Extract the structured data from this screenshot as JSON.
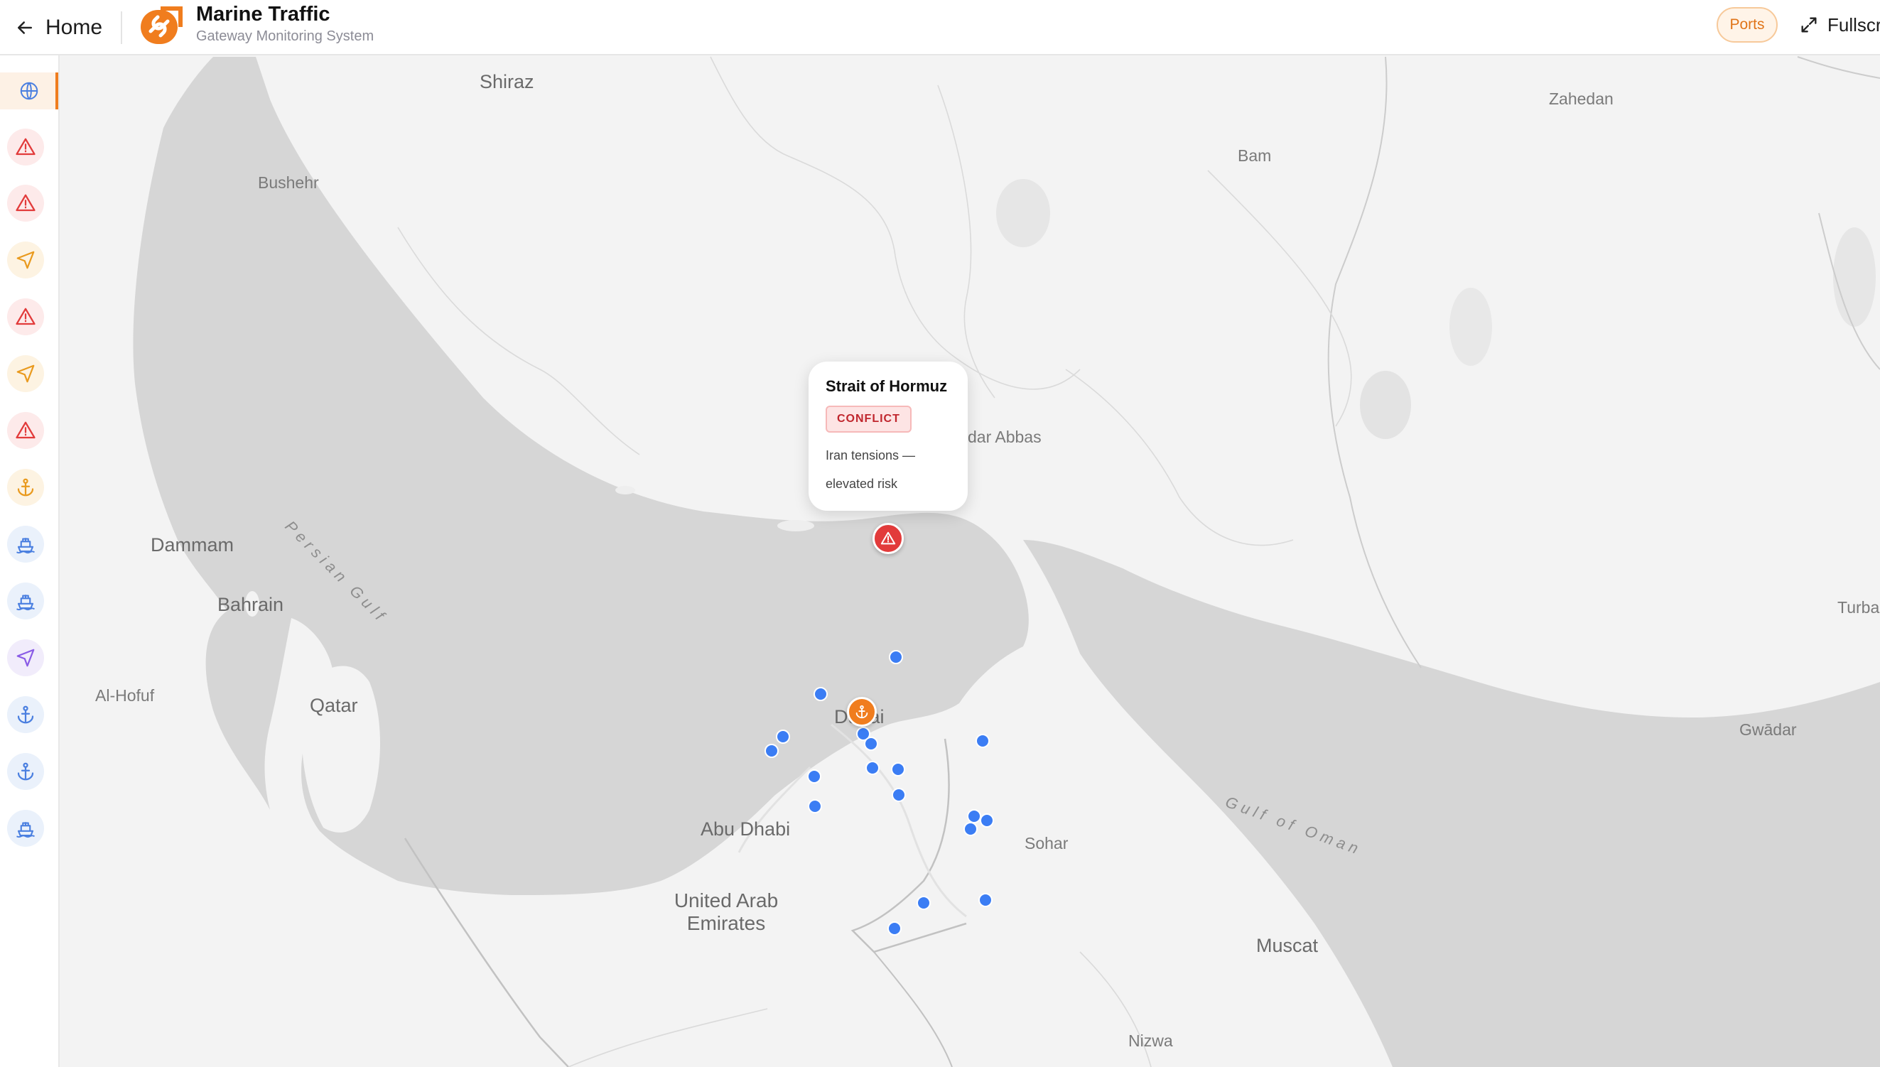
{
  "header": {
    "back_label": "Home",
    "title": "Marine Traffic",
    "subtitle": "Gateway Monitoring System",
    "ports_label": "Ports",
    "fullscreen_label": "Fullscreen"
  },
  "sidebar": {
    "items": [
      {
        "icon": "globe-icon",
        "color": "#4a7fe0",
        "active": true
      },
      {
        "icon": "alert-triangle-icon",
        "color": "#e23b3b"
      },
      {
        "icon": "alert-triangle-icon",
        "color": "#e23b3b"
      },
      {
        "icon": "navigation-icon",
        "color": "#e99a1e"
      },
      {
        "icon": "alert-triangle-icon",
        "color": "#e23b3b"
      },
      {
        "icon": "navigation-icon",
        "color": "#e99a1e"
      },
      {
        "icon": "alert-triangle-icon",
        "color": "#e23b3b"
      },
      {
        "icon": "anchor-icon",
        "color": "#e99a1e"
      },
      {
        "icon": "ship-icon",
        "color": "#4a7fe0"
      },
      {
        "icon": "ship-icon",
        "color": "#4a7fe0"
      },
      {
        "icon": "navigation-icon",
        "color": "#8a5ce6"
      },
      {
        "icon": "anchor-icon",
        "color": "#4a7fe0"
      },
      {
        "icon": "anchor-icon",
        "color": "#4a7fe0"
      },
      {
        "icon": "ship-icon",
        "color": "#4a7fe0"
      }
    ]
  },
  "map": {
    "labels": {
      "shiraz": "Shiraz",
      "zahedan": "Zahedan",
      "bam": "Bam",
      "bushehr": "Bushehr",
      "persian_gulf": "Persian Gulf",
      "bandar_abbas": "dar Abbas",
      "dammam": "Dammam",
      "bahrain": "Bahrain",
      "al_hofuf": "Al-Hofuf",
      "qatar": "Qatar",
      "dubai": "Dubai",
      "turbat": "Turba",
      "gwadar": "Gwādar",
      "gulf_of_oman": "Gulf of Oman",
      "abu_dhabi": "Abu Dhabi",
      "sohar": "Sohar",
      "uae": "United Arab Emirates",
      "muscat": "Muscat",
      "nizwa": "Nizwa"
    },
    "popup": {
      "title": "Strait of Hormuz",
      "badge": "CONFLICT",
      "description": "Iran tensions — elevated risk"
    },
    "colors": {
      "vessel": "#3b7df4",
      "alert": "#e23b3b",
      "port": "#f07d1e",
      "accent": "#f07d1e"
    }
  }
}
